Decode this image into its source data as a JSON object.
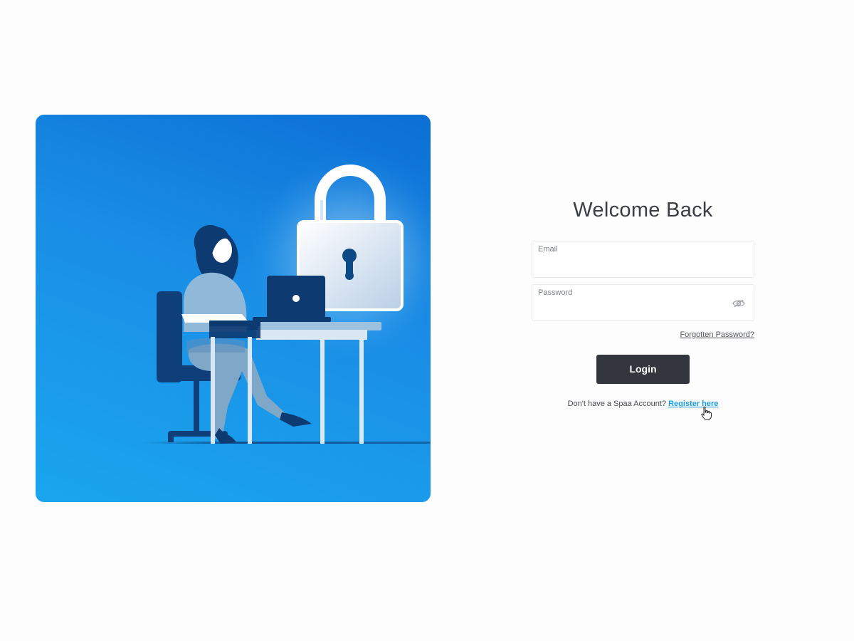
{
  "login": {
    "title": "Welcome Back",
    "email": {
      "label": "Email",
      "value": "",
      "placeholder": ""
    },
    "password": {
      "label": "Password",
      "value": "",
      "placeholder": ""
    },
    "forgot_label": "Forgotten Password?",
    "login_label": "Login",
    "register_prompt": "Don't have a Spaa Account?",
    "register_label": "Register here"
  },
  "icons": {
    "password_toggle": "eye-off-icon",
    "cursor": "hand-pointer-icon"
  },
  "colors": {
    "hero_dark": "#0b6fd4",
    "hero_light": "#1aa6ee",
    "button": "#33373d",
    "link": "#1a9de0",
    "title": "#3b3e44"
  }
}
